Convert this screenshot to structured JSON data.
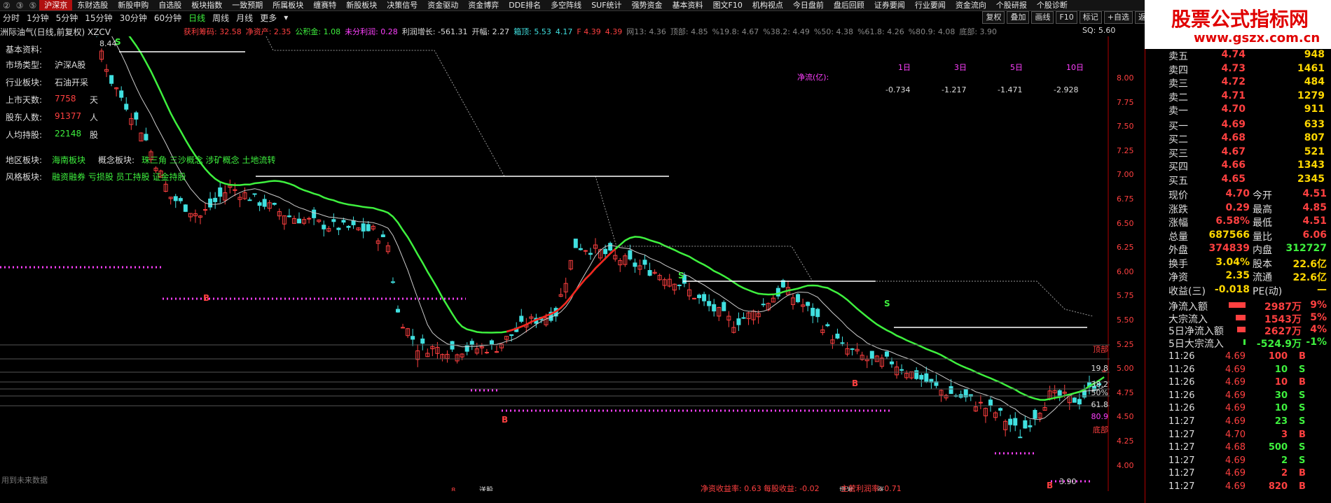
{
  "top_menu": {
    "nums": [
      "②",
      "③",
      "⑤"
    ],
    "items": [
      "沪深京",
      "东财选股",
      "新股申购",
      "自选股",
      "板块指数",
      "一致预期",
      "所属板块",
      "缠赛特",
      "新股板块",
      "决策信号",
      "资金驱动",
      "资金博弈",
      "DDE排名",
      "多空阵线",
      "SUF统计",
      "强势资金",
      "基本资料",
      "图文F10",
      "机构视点",
      "今日盘前",
      "盘后回顾",
      "证券要闻",
      "行业要闻",
      "资金流向",
      "个股研报",
      "个股诊断"
    ],
    "active_index": 0
  },
  "periods": {
    "items": [
      "分时",
      "1分钟",
      "5分钟",
      "15分钟",
      "30分钟",
      "60分钟",
      "日线",
      "周线",
      "月线",
      "更多"
    ],
    "active_index": 6,
    "more_arrow": "▾"
  },
  "tools": [
    "复权",
    "叠加",
    "画线",
    "F10",
    "标记",
    "+自选",
    "返回"
  ],
  "stock_title": "洲际油气(日线,前复权) XZCV",
  "indicator_line": [
    {
      "label": "获利筹码:",
      "value": "32.58",
      "color": "#ff4040"
    },
    {
      "label": "净资产:",
      "value": "2.35",
      "color": "#ff4040"
    },
    {
      "label": "公积金:",
      "value": "1.08",
      "color": "#3ef03e"
    },
    {
      "label": "未分利润:",
      "value": "0.28",
      "color": "#ff40ff"
    },
    {
      "label": "利润增长:",
      "value": "-561.31",
      "color": "#dddddd"
    },
    {
      "label": "开幅:",
      "value": "2.27",
      "color": "#dddddd"
    },
    {
      "label": "箱顶:",
      "value": "5.53",
      "color": "#40e0e0"
    },
    {
      "label": "",
      "value": "4.17",
      "color": "#40e0e0"
    },
    {
      "label": "F",
      "value": "4.39",
      "color": "#ff4040"
    },
    {
      "label": "",
      "value": "4.39",
      "color": "#ff4040"
    },
    {
      "label": "网13:",
      "value": "4.36",
      "color": "#888888"
    },
    {
      "label": "顶部:",
      "value": "4.85",
      "color": "#888888"
    },
    {
      "label": "%19.8:",
      "value": "4.67",
      "color": "#888888"
    },
    {
      "label": "%38.2:",
      "value": "4.49",
      "color": "#888888"
    },
    {
      "label": "%50:",
      "value": "4.38",
      "color": "#888888"
    },
    {
      "label": "%61.8:",
      "value": "4.26",
      "color": "#888888"
    },
    {
      "label": "%80.9:",
      "value": "4.08",
      "color": "#888888"
    },
    {
      "label": "底部:",
      "value": "3.90",
      "color": "#888888"
    }
  ],
  "sq": "SQ: 5.60",
  "info": {
    "basic_label": "基本资料:",
    "rows": [
      {
        "label": "市场类型:",
        "value": "沪深A股",
        "unit": ""
      },
      {
        "label": "行业板块:",
        "value": "石油开采",
        "unit": ""
      },
      {
        "label": "上市天数:",
        "value": "7758",
        "unit": "天"
      },
      {
        "label": "股东人数:",
        "value": "91377",
        "unit": "人"
      },
      {
        "label": "人均持股:",
        "value": "22148",
        "unit": "股"
      }
    ],
    "region_label": "地区板块:",
    "region_value": "海南板块",
    "concept_label": "概念板块:",
    "concept_value": "珠三角 三沙概念 涉矿概念 土地流转",
    "style_label": "风格板块:",
    "style_value": "融资融券 亏损股 员工持股 证金持股"
  },
  "flow_table": {
    "title": "净流(亿):",
    "headers": [
      "1日",
      "3日",
      "5日",
      "10日"
    ],
    "values": [
      "-0.734",
      "-1.217",
      "-1.471",
      "-2.928"
    ]
  },
  "chart_labels": {
    "high_label": "8.44",
    "low_label": "3.90",
    "signals_s": [
      "S",
      "S",
      "S"
    ],
    "signals_b": [
      "B",
      "B",
      "B",
      "B"
    ],
    "fib": [
      "顶部",
      "19.8",
      "38.2",
      "50%",
      "61.8",
      "80.9",
      "底部"
    ],
    "future_note": "用到未来数据",
    "bottom_markers": [
      "8",
      "送股",
      "增发",
      "涨"
    ],
    "bottom_stats": [
      {
        "label": "净资收益率:",
        "value": "0.63"
      },
      {
        "label": "每股收益:",
        "value": "-0.02"
      },
      {
        "label": "主营利润率:",
        "value": "0.71"
      }
    ],
    "current_tag": "5.17"
  },
  "price_axis": [
    "8.00",
    "7.75",
    "7.50",
    "7.25",
    "7.00",
    "6.75",
    "6.50",
    "6.25",
    "6.00",
    "5.75",
    "5.50",
    "5.25",
    "5.00",
    "4.75",
    "4.50",
    "4.25",
    "4.00"
  ],
  "ad": {
    "big": "股票公式指标网",
    "small": "www.gszx.com.cn"
  },
  "quotes": {
    "asks": [
      {
        "label": "卖五",
        "price": "4.74",
        "vol": "948"
      },
      {
        "label": "卖四",
        "price": "4.73",
        "vol": "1461"
      },
      {
        "label": "卖三",
        "price": "4.72",
        "vol": "484"
      },
      {
        "label": "卖二",
        "price": "4.71",
        "vol": "1279"
      },
      {
        "label": "卖一",
        "price": "4.70",
        "vol": "911"
      }
    ],
    "bids": [
      {
        "label": "买一",
        "price": "4.69",
        "vol": "633"
      },
      {
        "label": "买二",
        "price": "4.68",
        "vol": "807"
      },
      {
        "label": "买三",
        "price": "4.67",
        "vol": "521"
      },
      {
        "label": "买四",
        "price": "4.66",
        "vol": "1343"
      },
      {
        "label": "买五",
        "price": "4.65",
        "vol": "2345"
      }
    ]
  },
  "stats": [
    {
      "l1": "现价",
      "v1": "4.70",
      "c1": "#ff4040",
      "l2": "今开",
      "v2": "4.51",
      "c2": "#ff4040"
    },
    {
      "l1": "涨跌",
      "v1": "0.29",
      "c1": "#ff4040",
      "l2": "最高",
      "v2": "4.85",
      "c2": "#ff4040"
    },
    {
      "l1": "涨幅",
      "v1": "6.58%",
      "c1": "#ff4040",
      "l2": "最低",
      "v2": "4.51",
      "c2": "#ff4040"
    },
    {
      "l1": "总量",
      "v1": "687566",
      "c1": "#ffd700",
      "l2": "量比",
      "v2": "6.06",
      "c2": "#ff4040"
    },
    {
      "l1": "外盘",
      "v1": "374839",
      "c1": "#ff4040",
      "l2": "内盘",
      "v2": "312727",
      "c2": "#3ef03e"
    },
    {
      "l1": "换手",
      "v1": "3.04%",
      "c1": "#ffd700",
      "l2": "股本",
      "v2": "22.6亿",
      "c2": "#ffd700"
    },
    {
      "l1": "净资",
      "v1": "2.35",
      "c1": "#ffd700",
      "l2": "流通",
      "v2": "22.6亿",
      "c2": "#ffd700"
    },
    {
      "l1": "收益(三)",
      "v1": "-0.018",
      "c1": "#ffd700",
      "l2": "PE(动)",
      "v2": "—",
      "c2": "#ffd700"
    }
  ],
  "flows": [
    {
      "label": "净流入额",
      "value": "2987万",
      "pct": "9%",
      "color": "#ff4040",
      "bar": 24
    },
    {
      "label": "大宗流入",
      "value": "1543万",
      "pct": "5%",
      "color": "#ff4040",
      "bar": 14
    },
    {
      "label": "5日净流入额",
      "value": "2627万",
      "pct": "4%",
      "color": "#ff4040",
      "bar": 12
    },
    {
      "label": "5日大宗流入",
      "value": "-524.9万",
      "pct": "-1%",
      "color": "#3ef03e",
      "bar": 3
    }
  ],
  "ticks": [
    {
      "t": "11:26",
      "p": "4.69",
      "v": "100",
      "d": "B"
    },
    {
      "t": "11:26",
      "p": "4.69",
      "v": "10",
      "d": "S"
    },
    {
      "t": "11:26",
      "p": "4.69",
      "v": "10",
      "d": "B"
    },
    {
      "t": "11:26",
      "p": "4.69",
      "v": "30",
      "d": "S"
    },
    {
      "t": "11:26",
      "p": "4.69",
      "v": "10",
      "d": "S"
    },
    {
      "t": "11:27",
      "p": "4.69",
      "v": "23",
      "d": "S"
    },
    {
      "t": "11:27",
      "p": "4.70",
      "v": "3",
      "d": "B"
    },
    {
      "t": "11:27",
      "p": "4.68",
      "v": "500",
      "d": "S"
    },
    {
      "t": "11:27",
      "p": "4.69",
      "v": "2",
      "d": "S"
    },
    {
      "t": "11:27",
      "p": "4.69",
      "v": "2",
      "d": "B"
    },
    {
      "t": "11:27",
      "p": "4.69",
      "v": "820",
      "d": "B"
    }
  ],
  "colors": {
    "up": "#ff4040",
    "down": "#40e0e0",
    "ma_green": "#3ef03e",
    "ma_red": "#ff2020",
    "magenta": "#ff40ff"
  }
}
